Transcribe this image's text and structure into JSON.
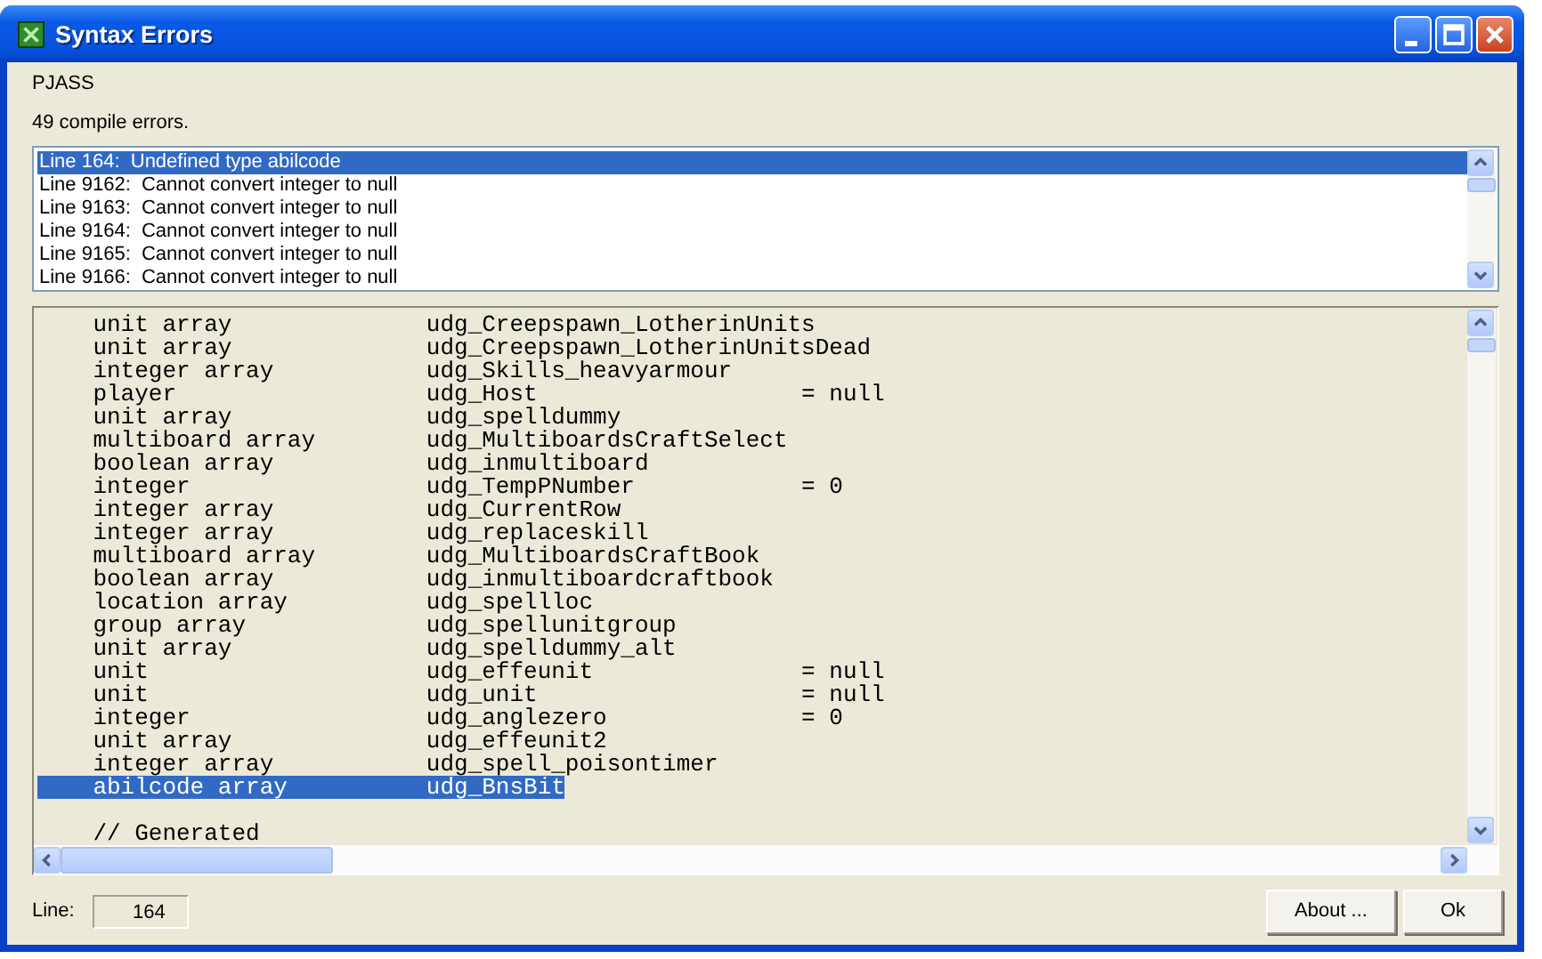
{
  "window": {
    "title": "Syntax Errors"
  },
  "checker": "PJASS",
  "summary": "49 compile errors.",
  "errors": [
    {
      "text": "Line 164:  Undefined type abilcode",
      "selected": true
    },
    {
      "text": "Line 9162:  Cannot convert integer to null",
      "selected": false
    },
    {
      "text": "Line 9163:  Cannot convert integer to null",
      "selected": false
    },
    {
      "text": "Line 9164:  Cannot convert integer to null",
      "selected": false
    },
    {
      "text": "Line 9165:  Cannot convert integer to null",
      "selected": false
    },
    {
      "text": "Line 9166:  Cannot convert integer to null",
      "selected": false
    }
  ],
  "code": [
    {
      "kind": "declaration",
      "type": "unit array",
      "name": "udg_Creepspawn_LotherinUnits",
      "selected": false
    },
    {
      "kind": "declaration",
      "type": "unit array",
      "name": "udg_Creepspawn_LotherinUnitsDead",
      "selected": false
    },
    {
      "kind": "declaration",
      "type": "integer array",
      "name": "udg_Skills_heavyarmour",
      "selected": false
    },
    {
      "kind": "declaration",
      "type": "player",
      "name": "udg_Host",
      "init": "= null",
      "selected": false
    },
    {
      "kind": "declaration",
      "type": "unit array",
      "name": "udg_spelldummy",
      "selected": false
    },
    {
      "kind": "declaration",
      "type": "multiboard array",
      "name": "udg_MultiboardsCraftSelect",
      "selected": false
    },
    {
      "kind": "declaration",
      "type": "boolean array",
      "name": "udg_inmultiboard",
      "selected": false
    },
    {
      "kind": "declaration",
      "type": "integer",
      "name": "udg_TempPNumber",
      "init": "= 0",
      "selected": false
    },
    {
      "kind": "declaration",
      "type": "integer array",
      "name": "udg_CurrentRow",
      "selected": false
    },
    {
      "kind": "declaration",
      "type": "integer array",
      "name": "udg_replaceskill",
      "selected": false
    },
    {
      "kind": "declaration",
      "type": "multiboard array",
      "name": "udg_MultiboardsCraftBook",
      "selected": false
    },
    {
      "kind": "declaration",
      "type": "boolean array",
      "name": "udg_inmultiboardcraftbook",
      "selected": false
    },
    {
      "kind": "declaration",
      "type": "location array",
      "name": "udg_spellloc",
      "selected": false
    },
    {
      "kind": "declaration",
      "type": "group array",
      "name": "udg_spellunitgroup",
      "selected": false
    },
    {
      "kind": "declaration",
      "type": "unit array",
      "name": "udg_spelldummy_alt",
      "selected": false
    },
    {
      "kind": "declaration",
      "type": "unit",
      "name": "udg_effeunit",
      "init": "= null",
      "selected": false
    },
    {
      "kind": "declaration",
      "type": "unit",
      "name": "udg_unit",
      "init": "= null",
      "selected": false
    },
    {
      "kind": "declaration",
      "type": "integer",
      "name": "udg_anglezero",
      "init": "= 0",
      "selected": false
    },
    {
      "kind": "declaration",
      "type": "unit array",
      "name": "udg_effeunit2",
      "selected": false
    },
    {
      "kind": "declaration",
      "type": "integer array",
      "name": "udg_spell_poisontimer",
      "selected": false
    },
    {
      "kind": "declaration",
      "type": "abilcode array",
      "name": "udg_BnsBit",
      "selected": true
    },
    {
      "kind": "blank"
    },
    {
      "kind": "comment",
      "text": "// Generated"
    }
  ],
  "line_field": {
    "label": "Line:",
    "value": "164"
  },
  "buttons": [
    "About ...",
    "Ok"
  ]
}
